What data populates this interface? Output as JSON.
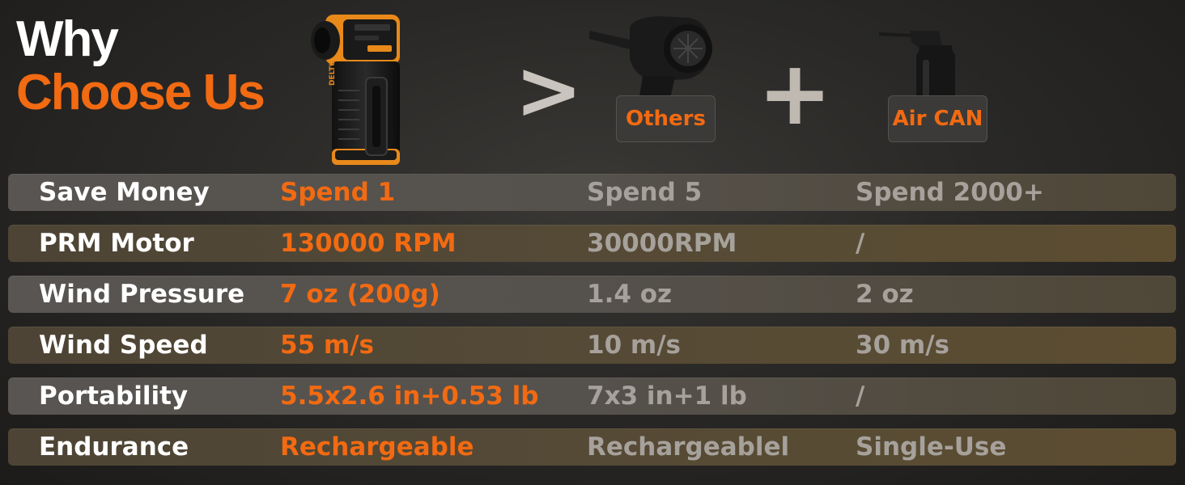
{
  "headline": {
    "line1": "Why",
    "line2": "Choose Us"
  },
  "products": {
    "ours": {
      "icon": "handheld-air-duster-icon",
      "brand_text": "DELTU"
    },
    "comparison_symbol": ">",
    "others": {
      "icon": "air-blower-gun-icon",
      "label": "Others"
    },
    "plus_symbol": "+",
    "aircan": {
      "icon": "compressed-air-can-icon",
      "label": "Air CAN"
    }
  },
  "colors": {
    "accent": "#f26a12",
    "primary_text": "#ffffff",
    "muted_text": "#a6a19b"
  },
  "rows": [
    {
      "feature": "Save Money",
      "ours": "Spend 1",
      "others": "Spend 5",
      "aircan": "Spend 2000+"
    },
    {
      "feature": "PRM Motor",
      "ours": "130000 RPM",
      "others": "30000RPM",
      "aircan": "/"
    },
    {
      "feature": "Wind Pressure",
      "ours": "7 oz (200g)",
      "others": "1.4 oz",
      "aircan": "2 oz"
    },
    {
      "feature": "Wind Speed",
      "ours": "55 m/s",
      "others": "10 m/s",
      "aircan": "30 m/s"
    },
    {
      "feature": "Portability",
      "ours": "5.5x2.6 in+0.53 lb",
      "others": "7x3 in+1 lb",
      "aircan": "/"
    },
    {
      "feature": "Endurance",
      "ours": "Rechargeable",
      "others": "Rechargeablel",
      "aircan": "Single-Use"
    }
  ]
}
